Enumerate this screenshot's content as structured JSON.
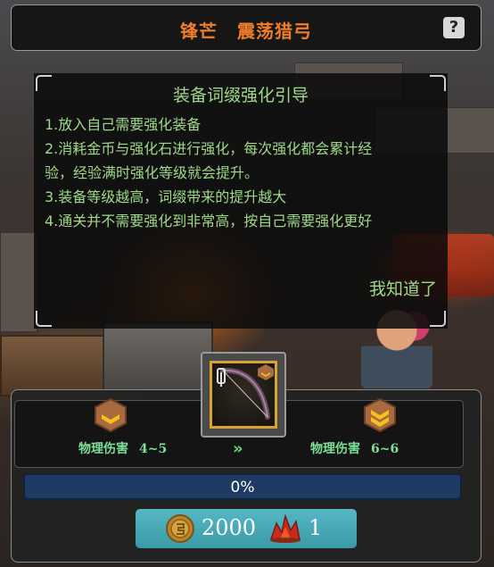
{
  "title": {
    "part1": "锋芒",
    "part2": "震荡猎弓"
  },
  "help_label": "?",
  "guide": {
    "heading": "装备词缀强化引导",
    "lines": [
      "1.放入自己需要强化装备",
      "2.消耗金币与强化石进行强化，每次强化都会累计经",
      "验，经验满时强化等级就会提升。",
      "3.装备等级越高，词缀带来的提升越大",
      "4.通关并不需要强化到非常高，按自己需要强化更好"
    ],
    "ack_label": "我知道了"
  },
  "compare": {
    "current": {
      "label": "物理伤害",
      "value": "4~5"
    },
    "next": {
      "label": "物理伤害",
      "value": "6~6"
    },
    "arrow": "»"
  },
  "progress": {
    "text": "0%",
    "fraction": 0
  },
  "cost": {
    "gold": "2000",
    "stone": "1"
  },
  "colors": {
    "title": "#ef7d2a",
    "guide_text": "#9fd88a",
    "stat_text": "#7ddf9a",
    "button": "#4aa9b6"
  }
}
